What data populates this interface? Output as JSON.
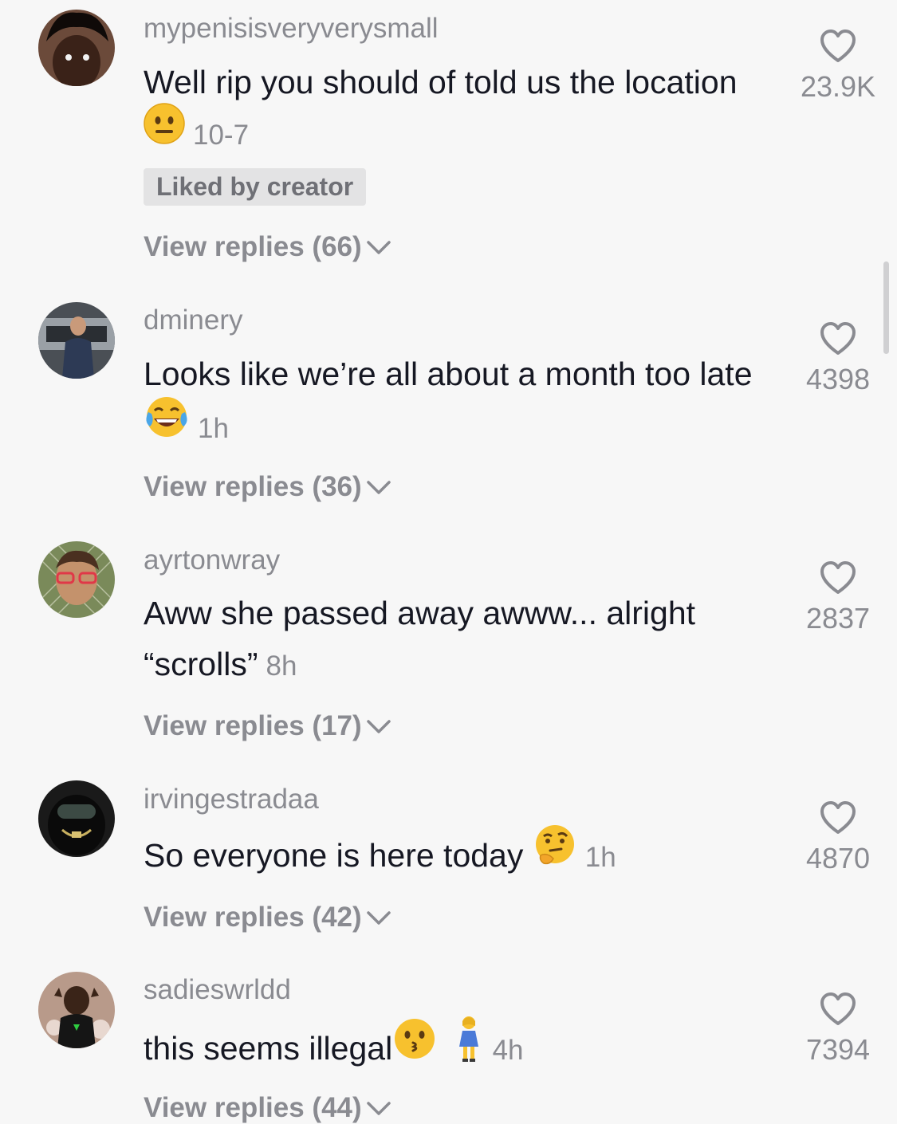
{
  "comments": [
    {
      "username": "mypenisisveryverysmall",
      "text": "Well rip you should of told us the location",
      "emoji": "neutral-face",
      "time": "10-7",
      "badge": "Liked by creator",
      "replies": "View replies (66)",
      "likes": "23.9K"
    },
    {
      "username": "dminery",
      "text": "Looks like we’re all about a month too late",
      "emoji": "tears-of-joy",
      "time": "1h",
      "replies": "View replies (36)",
      "likes": "4398"
    },
    {
      "username": "ayrtonwray",
      "text": "Aww she passed away awww... alright “scrolls”",
      "time": "8h",
      "replies": "View replies (17)",
      "likes": "2837"
    },
    {
      "username": "irvingestradaa",
      "text": "So everyone is here today",
      "emoji": "thinking-face",
      "time": "1h",
      "replies": "View replies (42)",
      "likes": "4870"
    },
    {
      "username": "sadieswrldd",
      "text": "this seems illegal",
      "emoji": "kissing-face, woman-standing",
      "time": "4h",
      "replies": "View replies (44)",
      "likes": "7394"
    }
  ],
  "colors": {
    "background": "#f7f7f7",
    "primary_text": "#161823",
    "secondary_text": "#8a8b91",
    "badge_bg": "#e3e3e4"
  }
}
